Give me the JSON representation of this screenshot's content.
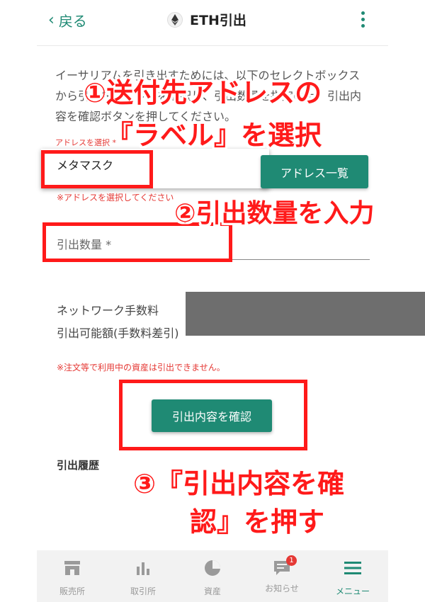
{
  "header": {
    "back_label": "戻る",
    "title": "ETH引出"
  },
  "form": {
    "description": "イーサリアムを引き出すためには、以下のセレクトボックスから引出先アドレスを選択し、引出数量を指定の上、引出内容を確認ボタンを押してください。",
    "address_label": "アドレスを選択 *",
    "address_selected": "メタマスク",
    "address_list_button": "アドレス一覧",
    "address_hint": "※アドレスを選択してください",
    "amount_placeholder": "引出数量 *",
    "fee_label": "ネットワーク手数料",
    "available_label": "引出可能額(手数料差引)",
    "warning": "※注文等で利用中の資産は引出できません。",
    "confirm_button": "引出内容を確認",
    "history_title": "引出履歴"
  },
  "annotations": {
    "step1_line1": "①送付先アドレスの",
    "step1_line2": "『ラベル』を選択",
    "step2": "②引出数量を入力",
    "step3_line1": "③『引出内容を確",
    "step3_line2": "認』を押す"
  },
  "nav": {
    "items": [
      {
        "label": "販売所",
        "icon": "shop-icon"
      },
      {
        "label": "取引所",
        "icon": "chart-bars-icon"
      },
      {
        "label": "資産",
        "icon": "pie-chart-icon"
      },
      {
        "label": "お知らせ",
        "icon": "message-icon",
        "badge": "1"
      },
      {
        "label": "メニュー",
        "icon": "hamburger-icon"
      }
    ]
  },
  "colors": {
    "accent": "#1f8a74",
    "annotation": "#ff1a1a",
    "error": "#e53935"
  }
}
